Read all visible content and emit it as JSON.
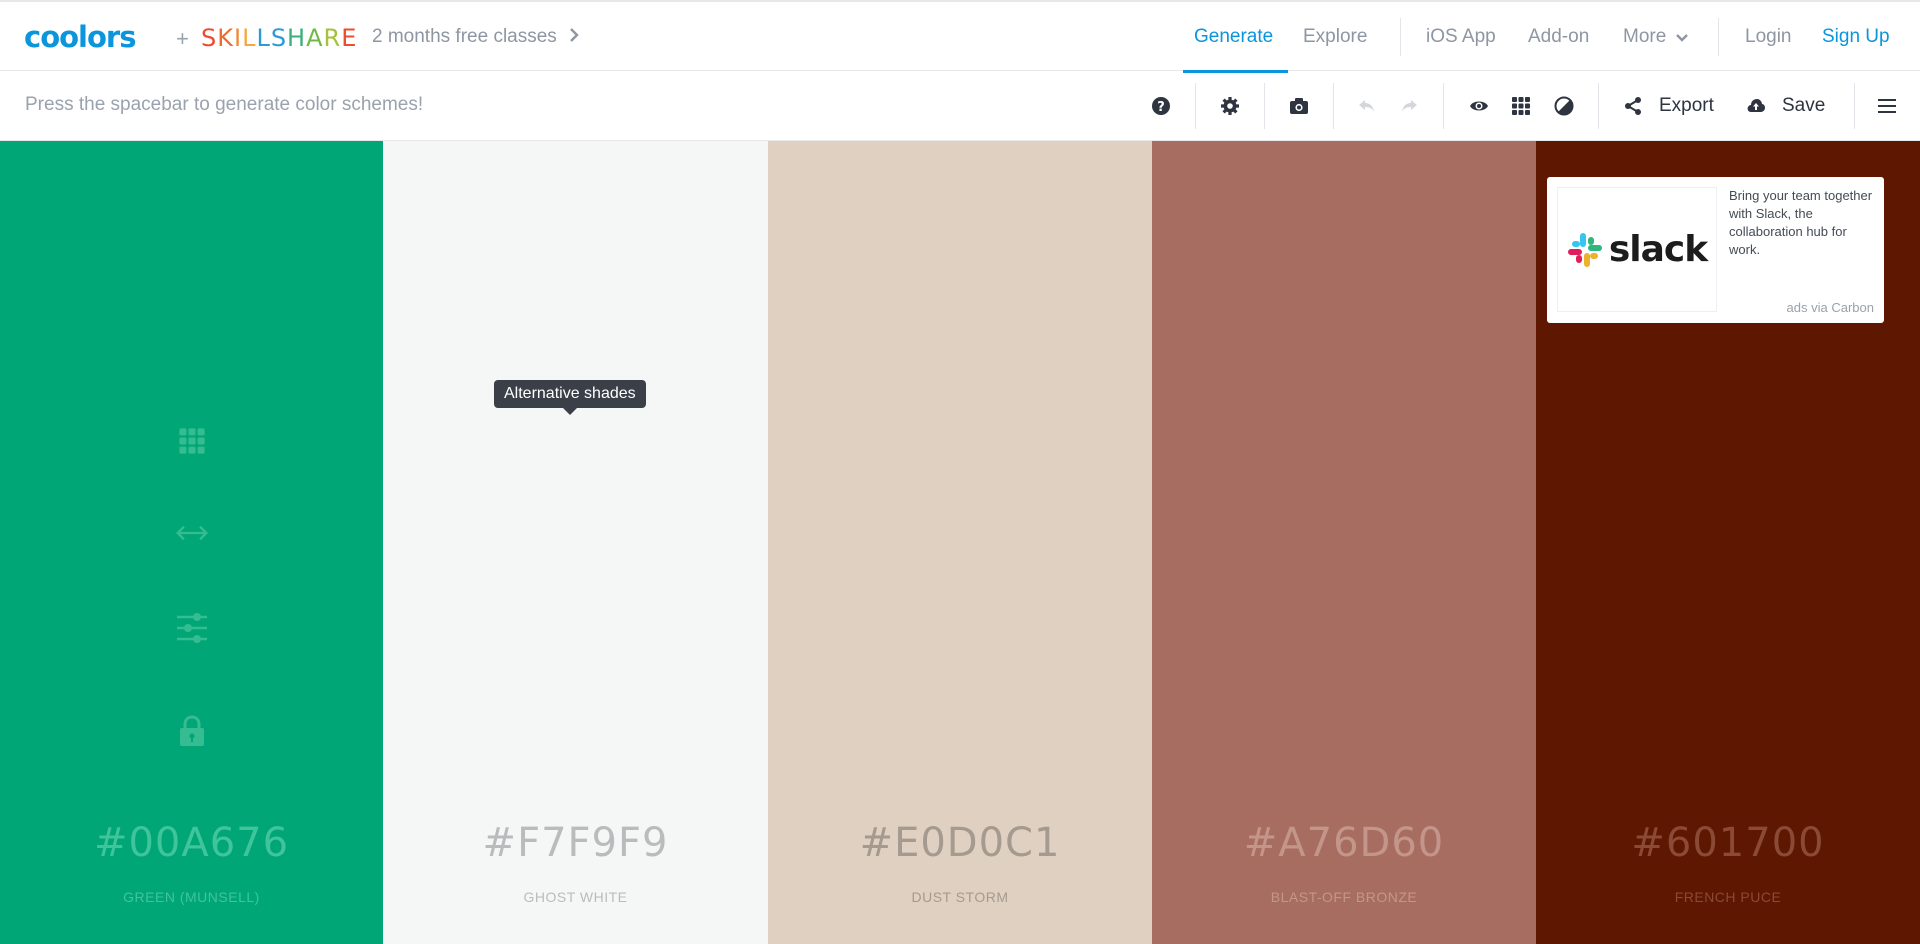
{
  "header": {
    "logo": "coolors",
    "plus": "+",
    "partner": [
      "S",
      "K",
      "I",
      "L",
      "L",
      "S",
      "H",
      "A",
      "R",
      "E"
    ],
    "partner_colors": [
      "#ef4b2d",
      "#ef6a2f",
      "#f28a34",
      "#f5a93b",
      "#2b9bd8",
      "#2b9bd8",
      "#3bb07c",
      "#71b946",
      "#a6c23c",
      "#ef4b2d"
    ],
    "promo": "2 months free classes",
    "nav": {
      "generate": "Generate",
      "explore": "Explore",
      "ios": "iOS App",
      "addon": "Add-on",
      "more": "More",
      "login": "Login",
      "signup": "Sign Up"
    },
    "accent": "#0a95dd"
  },
  "toolbar": {
    "hint": "Press the spacebar to generate color schemes!",
    "export": "Export",
    "save": "Save"
  },
  "palette": [
    {
      "hex": "#00A676",
      "name": "GREEN (MUNSELL)",
      "bg": "#00a676",
      "text": "#3fc49b"
    },
    {
      "hex": "#F7F9F9",
      "name": "GHOST WHITE",
      "bg": "#f5f7f7",
      "text": "#b9bcbd"
    },
    {
      "hex": "#E0D0C1",
      "name": "DUST STORM",
      "bg": "#e0d0c1",
      "text": "#a59a8f"
    },
    {
      "hex": "#A76D60",
      "name": "BLAST-OFF BRONZE",
      "bg": "#a76d60",
      "text": "#c4958b"
    },
    {
      "hex": "#601700",
      "name": "FRENCH PUCE",
      "bg": "#5e1700",
      "text": "#8a4a35"
    }
  ],
  "tooltip": "Alternative shades",
  "ad": {
    "brand": "slack",
    "text": "Bring your team together with Slack, the collaboration hub for work.",
    "via": "ads via Carbon"
  }
}
